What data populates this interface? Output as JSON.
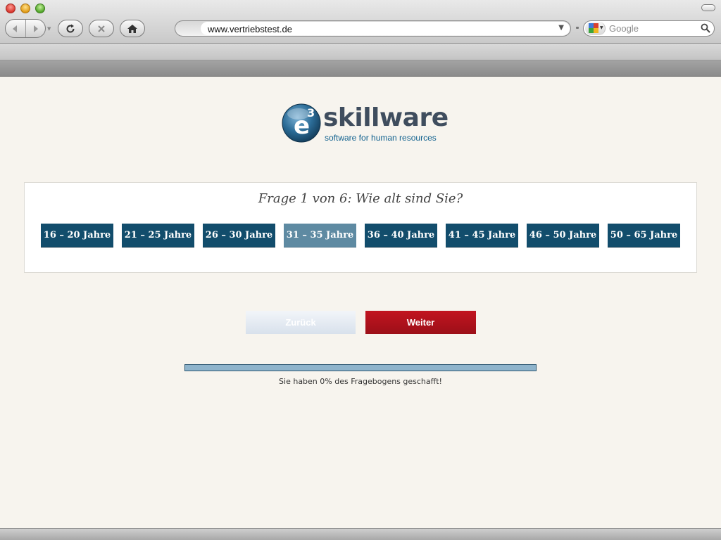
{
  "browser": {
    "url": "www.vertriebstest.de",
    "search_placeholder": "Google"
  },
  "logo": {
    "wordmark": "skillware",
    "tagline": "software for human resources",
    "badge_text": "e3"
  },
  "question": {
    "title": "Frage 1 von 6: Wie alt sind Sie?",
    "options": [
      {
        "label": "16 – 20 Jahre",
        "selected": false
      },
      {
        "label": "21 – 25 Jahre",
        "selected": false
      },
      {
        "label": "26 – 30 Jahre",
        "selected": false
      },
      {
        "label": "31 – 35 Jahre",
        "selected": true
      },
      {
        "label": "36 – 40 Jahre",
        "selected": false
      },
      {
        "label": "41 – 45 Jahre",
        "selected": false
      },
      {
        "label": "46 – 50 Jahre",
        "selected": false
      },
      {
        "label": "50 – 65 Jahre",
        "selected": false
      }
    ]
  },
  "navigation": {
    "back_label": "Zurück",
    "next_label": "Weiter"
  },
  "progress": {
    "percent": 0,
    "text": "Sie haben 0% des Fragebogens geschafft!"
  },
  "colors": {
    "option_bg": "#124d6c",
    "option_selected_bg": "#5e8aa2",
    "next_button": "#b3121c",
    "page_bg": "#f7f4ee"
  }
}
